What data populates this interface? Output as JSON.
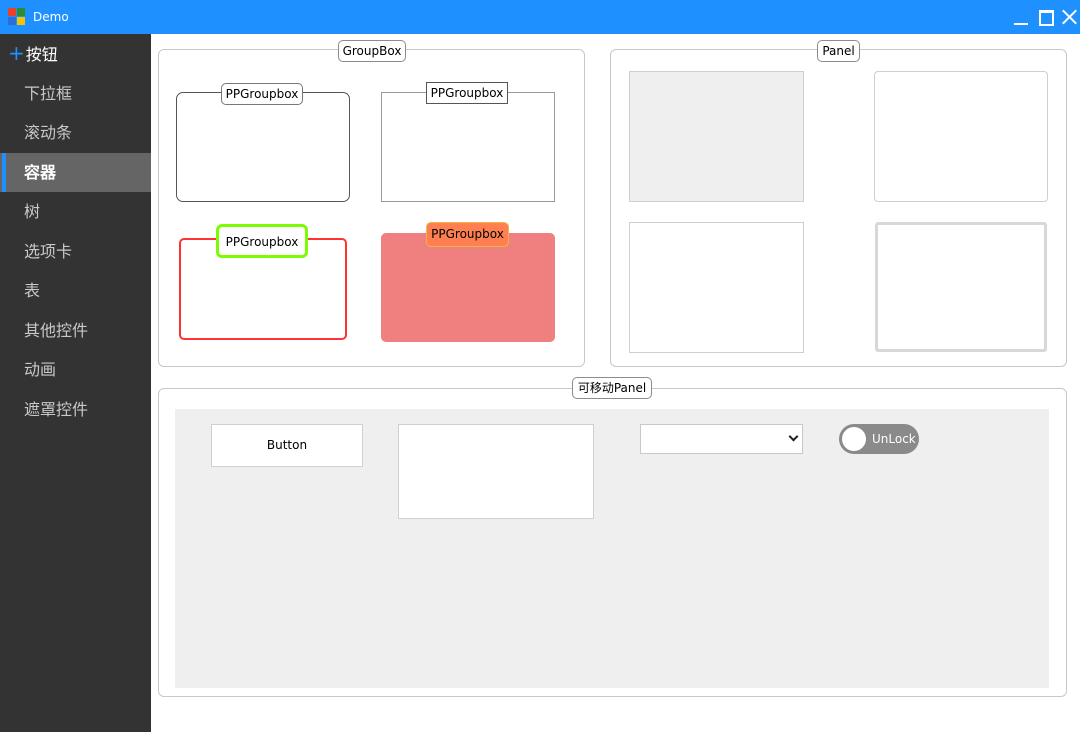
{
  "window": {
    "title": "Demo",
    "controls": {
      "minimize": "minimize-icon",
      "maximize": "maximize-icon",
      "close": "close-icon"
    }
  },
  "sidebar": {
    "items": [
      {
        "label": "按钮",
        "icon": "plus-icon"
      },
      {
        "label": "下拉框"
      },
      {
        "label": "滚动条"
      },
      {
        "label": "容器",
        "active": true
      },
      {
        "label": "树"
      },
      {
        "label": "选项卡"
      },
      {
        "label": "表"
      },
      {
        "label": "其他控件"
      },
      {
        "label": "动画"
      },
      {
        "label": "遮罩控件"
      }
    ]
  },
  "groupbox_section": {
    "caption": "GroupBox",
    "boxes": [
      {
        "caption": "PPGroupbox",
        "style": "rounded"
      },
      {
        "caption": "PPGroupbox",
        "style": "square"
      },
      {
        "caption": "PPGroupbox",
        "style": "red-border-green-caption",
        "border_color": "#ff3333",
        "caption_border_color": "#7cfc00"
      },
      {
        "caption": "PPGroupbox",
        "style": "filled",
        "fill_color": "#f08080",
        "caption_fill_color": "#ff7f50"
      }
    ]
  },
  "panel_section": {
    "caption": "Panel"
  },
  "movable_panel": {
    "caption": "可移动Panel",
    "button_label": "Button",
    "select_value": "",
    "toggle_label": "UnLock"
  },
  "colors": {
    "accent": "#1e90ff",
    "sidebar_bg": "#333333",
    "sidebar_active": "#656565"
  }
}
